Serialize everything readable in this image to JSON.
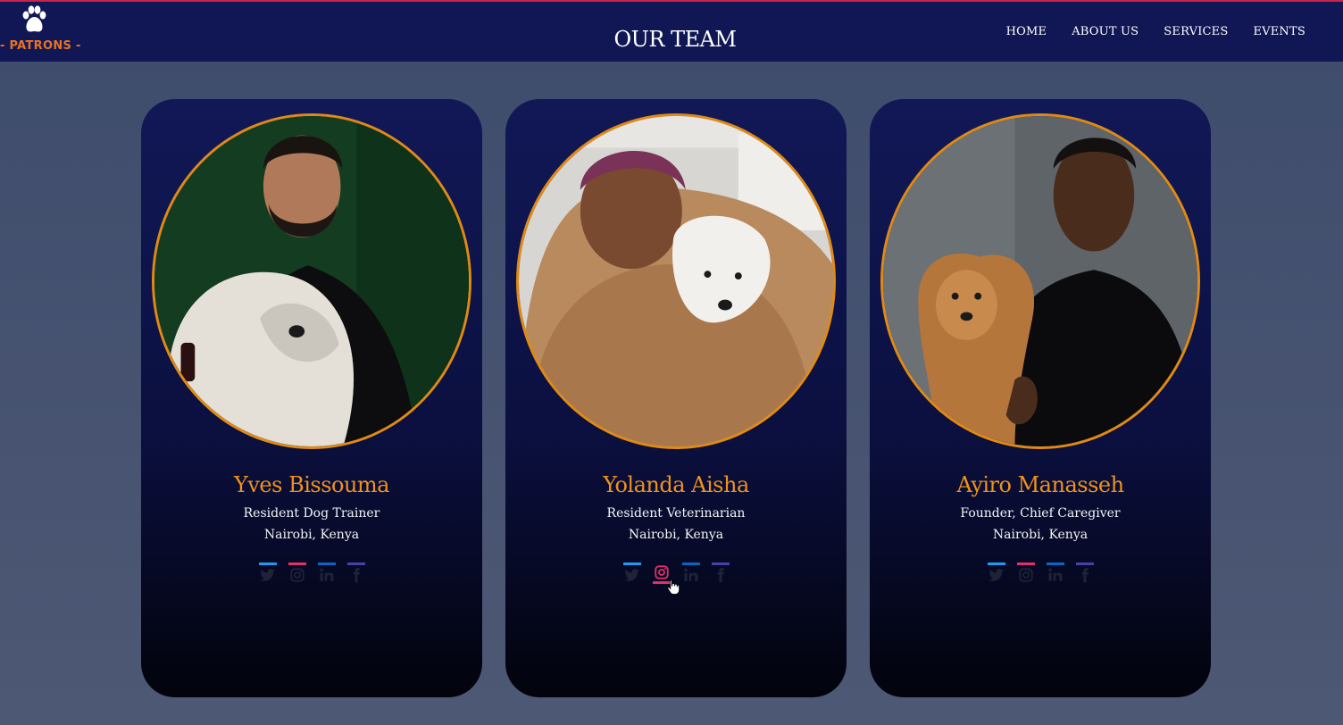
{
  "header": {
    "logo_text": "- PATRONS -",
    "title": "OUR TEAM",
    "nav": [
      {
        "label": "HOME"
      },
      {
        "label": "ABOUT US"
      },
      {
        "label": "SERVICES"
      },
      {
        "label": "EVENTS"
      }
    ]
  },
  "team": [
    {
      "name": "Yves Bissouma",
      "role": "Resident Dog Trainer",
      "location": "Nairobi, Kenya"
    },
    {
      "name": "Yolanda Aisha",
      "role": "Resident Veterinarian",
      "location": "Nairobi, Kenya"
    },
    {
      "name": "Ayiro Manasseh",
      "role": "Founder, Chief Caregiver",
      "location": "Nairobi, Kenya"
    }
  ],
  "social_icons": [
    "twitter-icon",
    "instagram-icon",
    "linkedin-icon",
    "facebook-icon"
  ],
  "colors": {
    "nav_bg": "#111755",
    "accent_orange": "#e08a15",
    "name_color": "#ef921d",
    "twitter": "#1d9bf0",
    "instagram": "#e1306c",
    "linkedin": "#0a66c2",
    "facebook": "#4b3fa8"
  }
}
